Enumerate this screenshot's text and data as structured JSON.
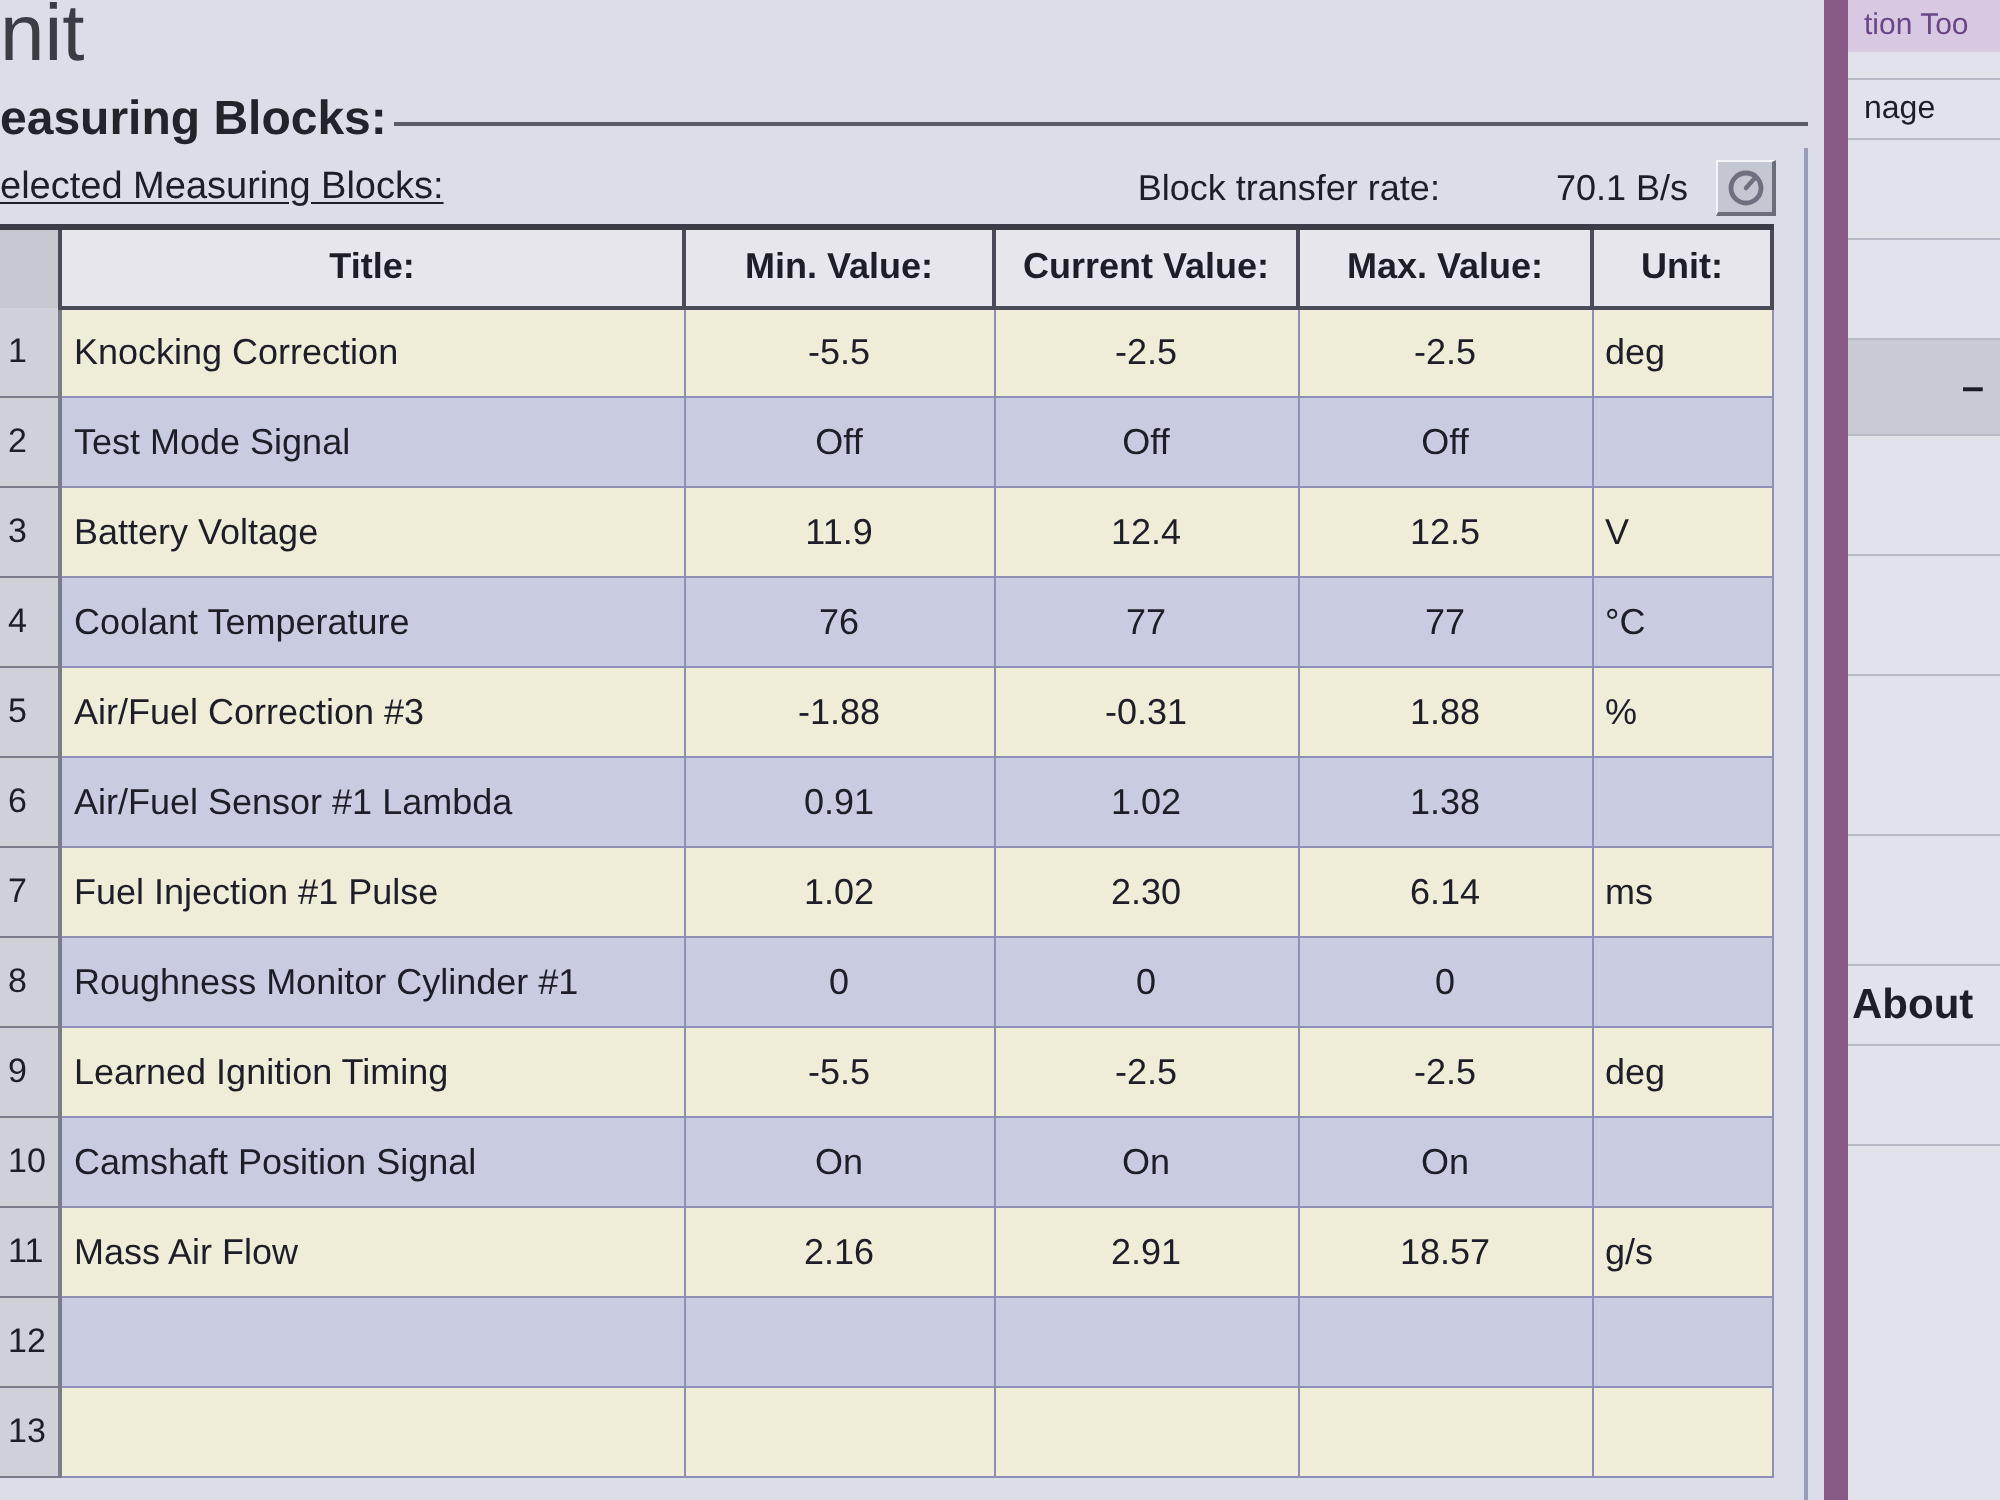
{
  "window": {
    "title": "nit"
  },
  "group": {
    "title": "easuring Blocks:",
    "section_label": "elected Measuring Blocks:",
    "transfer_rate_label": "Block transfer rate:",
    "transfer_rate": "70.1 B/s"
  },
  "table": {
    "columns": [
      "Title:",
      "Min. Value:",
      "Current Value:",
      "Max. Value:",
      "Unit:"
    ],
    "rows": [
      {
        "number": "1",
        "title": "Knocking Correction",
        "min": "-5.5",
        "current": "-2.5",
        "max": "-2.5",
        "unit": "deg"
      },
      {
        "number": "2",
        "title": "Test Mode Signal",
        "min": "Off",
        "current": "Off",
        "max": "Off"
      },
      {
        "number": "3",
        "title": "Battery Voltage",
        "min": "11.9",
        "current": "12.4",
        "max": "12.5",
        "unit": "V"
      },
      {
        "number": "4",
        "title": "Coolant Temperature",
        "min": "76",
        "current": "77",
        "max": "77",
        "unit": "°C"
      },
      {
        "number": "5",
        "title": "Air/Fuel Correction #3",
        "min": "-1.88",
        "current": "-0.31",
        "max": "1.88",
        "unit": "%"
      },
      {
        "number": "6",
        "title": "Air/Fuel Sensor #1 Lambda",
        "min": "0.91",
        "current": "1.02",
        "max": "1.38"
      },
      {
        "number": "7",
        "title": "Fuel Injection #1 Pulse",
        "min": "1.02",
        "current": "2.30",
        "max": "6.14",
        "unit": "ms"
      },
      {
        "number": "8",
        "title": "Roughness Monitor Cylinder #1",
        "min": "0",
        "current": "0",
        "max": "0"
      },
      {
        "number": "9",
        "title": "Learned Ignition Timing",
        "min": "-5.5",
        "current": "-2.5",
        "max": "-2.5",
        "unit": "deg"
      },
      {
        "number": "10",
        "title": "Camshaft Position Signal",
        "min": "On",
        "current": "On",
        "max": "On"
      },
      {
        "number": "11",
        "title": "Mass Air Flow",
        "min": "2.16",
        "current": "2.91",
        "max": "18.57",
        "unit": "g/s"
      },
      {
        "number": "12"
      },
      {
        "number": "13"
      }
    ]
  },
  "side_panel": {
    "tab": "tion Too",
    "menu_item": "nage",
    "button": "–",
    "about_link": "About"
  }
}
